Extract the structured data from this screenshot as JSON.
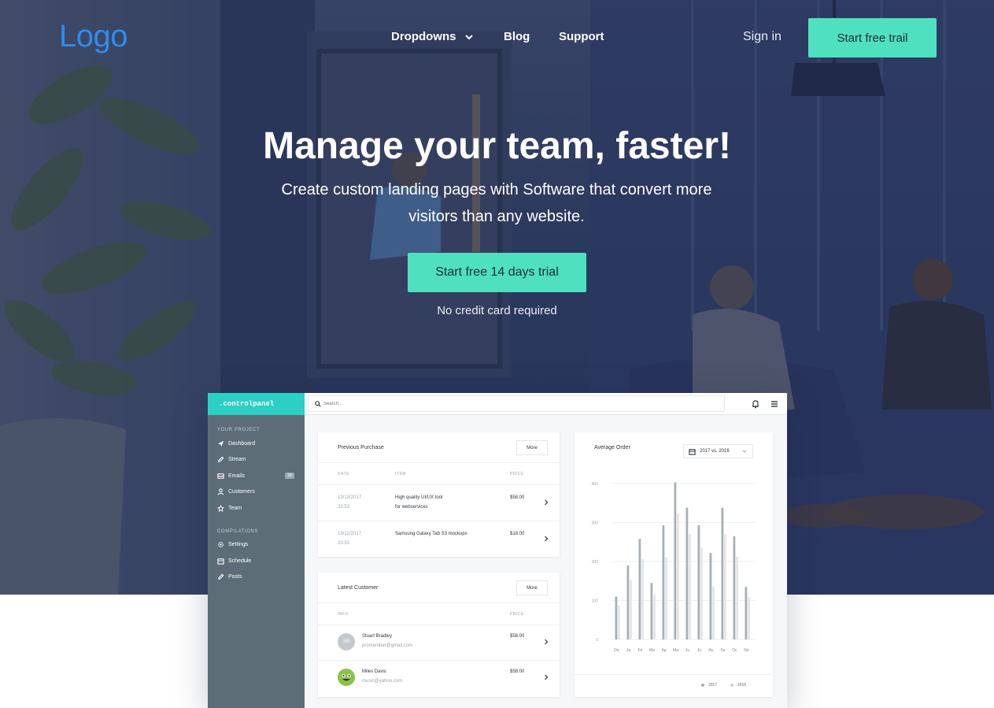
{
  "nav": {
    "logo": "Logo",
    "links": [
      "Dropdowns",
      "Blog",
      "Support"
    ],
    "sign_in": "Sign in",
    "cta": "Start free trail"
  },
  "hero": {
    "title": "Manage your team, faster!",
    "subtitle": "Create custom landing pages with Software that convert more visitors than any website.",
    "cta": "Start free 14 days trial",
    "note": "No credit card required"
  },
  "dashboard": {
    "brand": ".controlpanel",
    "search_placeholder": "Search...",
    "sidebar": {
      "section1": "YOUR PROJECT",
      "items1": [
        {
          "label": "Dashboard",
          "icon": "paper-plane-icon"
        },
        {
          "label": "Stream",
          "icon": "pencil-icon"
        },
        {
          "label": "Emails",
          "icon": "inbox-icon",
          "badge": "18"
        },
        {
          "label": "Customers",
          "icon": "users-icon"
        },
        {
          "label": "Team",
          "icon": "star-icon"
        }
      ],
      "section2": "COMPILATIONS",
      "items2": [
        {
          "label": "Settings",
          "icon": "gear-icon"
        },
        {
          "label": "Schedule",
          "icon": "calendar-icon"
        },
        {
          "label": "Posts",
          "icon": "pencil-icon"
        }
      ]
    },
    "purchase": {
      "title": "Previous Purchase",
      "more": "More",
      "headers": [
        "DATE",
        "ITEM",
        "PRICE"
      ],
      "rows": [
        {
          "date": "13/12/2017",
          "time": "23:53",
          "item1": "High quality UI/UX tool",
          "item2": "for webservices",
          "price": "$58.00"
        },
        {
          "date": "13/12/2017",
          "time": "23:53",
          "item1": "Samsung Galaxy Tab S3 mockups",
          "item2": "",
          "price": "$18.00"
        }
      ]
    },
    "customers": {
      "title": "Latest Customer",
      "more": "More",
      "headers": [
        "INFO",
        "PRICE"
      ],
      "rows": [
        {
          "initials": "SB",
          "name": "Stuart Bradley",
          "email": "promember@gmail.com",
          "price": "$58.00"
        },
        {
          "initials": "",
          "name": "Miles Davis",
          "email": "music@yahoo.com",
          "price": "$58.00"
        }
      ]
    },
    "order": {
      "title": "Average Order",
      "range": "2017 vs. 2016"
    }
  },
  "chart_data": {
    "type": "bar",
    "title": "Average Order",
    "categories": [
      "De",
      "Ja",
      "Fe",
      "Ma",
      "Ap",
      "Ma",
      "Ju",
      "Ju",
      "Au",
      "Se",
      "Oc",
      "No"
    ],
    "series": [
      {
        "name": "2017",
        "color": "#a6b0b6",
        "values": [
          110,
          190,
          258,
          145,
          293,
          403,
          338,
          293,
          222,
          338,
          265,
          135
        ]
      },
      {
        "name": "2016",
        "color": "#e3e7ea",
        "values": [
          88,
          153,
          206,
          116,
          212,
          323,
          271,
          236,
          136,
          270,
          212,
          108
        ]
      }
    ],
    "yticks": [
      "0",
      "100",
      "200",
      "300",
      "400"
    ],
    "ylim": [
      0,
      400
    ],
    "grid": true,
    "legend": "bottom-right"
  },
  "colors": {
    "accent": "#4fe0bf",
    "logo": "#2d8cf0",
    "sidebar": "#5c6d77",
    "brand_bar": "#2bcfc4"
  }
}
